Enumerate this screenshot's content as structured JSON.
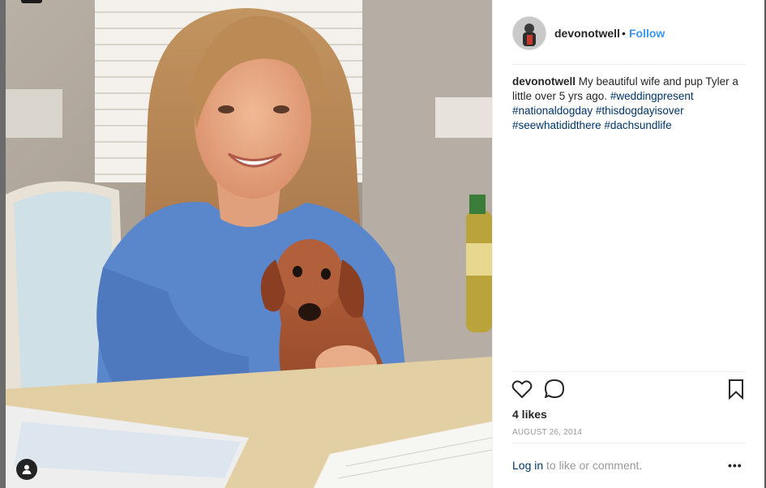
{
  "post": {
    "username": "devonotwell",
    "separator": "•",
    "follow_label": "Follow",
    "caption": {
      "author": "devonotwell",
      "text": "My beautiful wife and pup Tyler a little over 5 yrs ago.",
      "hashtags": [
        "#weddingpresent",
        "#nationaldogday",
        "#thisdogdayisover",
        "#seewhatididthere",
        "#dachsundlife"
      ]
    },
    "likes": "4 likes",
    "date": "August 26, 2014",
    "footer": {
      "login_label": "Log in",
      "suffix": "to like or comment.",
      "more_label": "•••"
    }
  },
  "icons": {
    "like": "heart-icon",
    "comment": "comment-icon",
    "save": "bookmark-icon",
    "tagged_people": "person-icon"
  },
  "colors": {
    "link": "#3897f0",
    "hashtag": "#003569",
    "text": "#262626",
    "muted": "#999999"
  }
}
